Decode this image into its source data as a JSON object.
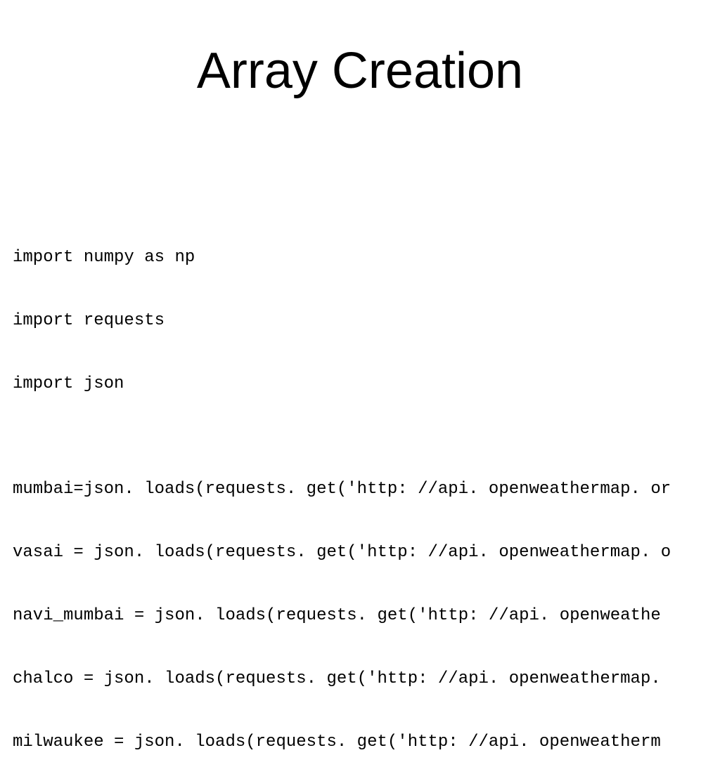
{
  "title": "Array Creation",
  "code": {
    "lines": [
      "import numpy as np",
      "import requests",
      "import json",
      "",
      "mumbai=json. loads(requests. get('http: //api. openweathermap. or",
      "vasai = json. loads(requests. get('http: //api. openweathermap. o",
      "navi_mumbai = json. loads(requests. get('http: //api. openweathe",
      "chalco = json. loads(requests. get('http: //api. openweathermap.",
      "milwaukee = json. loads(requests. get('http: //api. openweatherm"
    ]
  }
}
